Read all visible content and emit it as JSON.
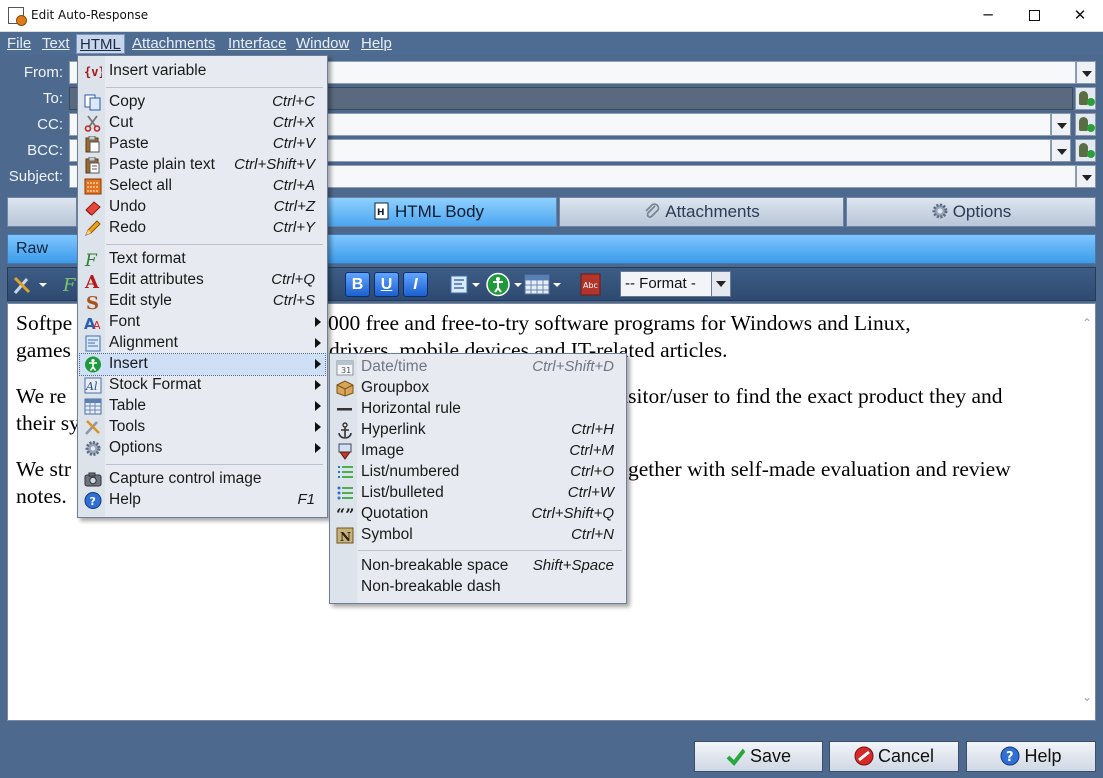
{
  "window": {
    "title": "Edit Auto-Response",
    "minimize": "─",
    "close": "✕"
  },
  "menubar": [
    "File",
    "Text",
    "HTML",
    "Attachments",
    "Interface",
    "Window",
    "Help"
  ],
  "fields": {
    "from_label": "From:",
    "to_label": "To:",
    "cc_label": "CC:",
    "bcc_label": "BCC:",
    "subject_label": "Subject:",
    "from_value": "",
    "to_value": "",
    "cc_value": "",
    "bcc_value": "",
    "subject_value": ""
  },
  "tabs": {
    "html_body": "HTML Body",
    "attachments": "Attachments",
    "options": "Options"
  },
  "subtab": "Raw",
  "toolbar": {
    "bold": "B",
    "underline": "U",
    "italic": "I",
    "format_select": "-- Format -"
  },
  "editor": {
    "p1_visible_start": "Softpe",
    "p1_visible_mid": "00.000 free and free-to-try software programs for Windows and Linux,",
    "p1_line2_start": "games",
    "p1_line2_end": "drivers, mobile devices and IT-related articles.",
    "p2_start": "We re",
    "p2_end": "isitor/user to find the exact product they and",
    "p2_line2_start": "their sy",
    "p3_start": "We str",
    "p3_end": "gether with self-made evaluation and review",
    "p3_line2": "notes."
  },
  "html_menu": {
    "items": [
      {
        "label": "Insert variable",
        "shortcut": "",
        "icon": "variable-icon"
      },
      {
        "label": "Copy",
        "shortcut": "Ctrl+C",
        "icon": "copy-icon"
      },
      {
        "label": "Cut",
        "shortcut": "Ctrl+X",
        "icon": "scissors-icon"
      },
      {
        "label": "Paste",
        "shortcut": "Ctrl+V",
        "icon": "paste-icon"
      },
      {
        "label": "Paste plain text",
        "shortcut": "Ctrl+Shift+V",
        "icon": "paste-plain-icon"
      },
      {
        "label": "Select all",
        "shortcut": "Ctrl+A",
        "icon": "select-all-icon"
      },
      {
        "label": "Undo",
        "shortcut": "Ctrl+Z",
        "icon": "eraser-icon"
      },
      {
        "label": "Redo",
        "shortcut": "Ctrl+Y",
        "icon": "pencil-icon"
      },
      {
        "label": "Text format",
        "shortcut": "",
        "icon": "text-format-icon"
      },
      {
        "label": "Edit attributes",
        "shortcut": "Ctrl+Q",
        "icon": "letter-a-icon"
      },
      {
        "label": "Edit style",
        "shortcut": "Ctrl+S",
        "icon": "letter-s-icon"
      },
      {
        "label": "Font",
        "shortcut": "",
        "icon": "font-icon"
      },
      {
        "label": "Alignment",
        "shortcut": "",
        "icon": "alignment-icon"
      },
      {
        "label": "Insert",
        "shortcut": "",
        "icon": "insert-icon"
      },
      {
        "label": "Stock Format",
        "shortcut": "",
        "icon": "stock-format-icon"
      },
      {
        "label": "Table",
        "shortcut": "",
        "icon": "table-icon"
      },
      {
        "label": "Tools",
        "shortcut": "",
        "icon": "tools-icon"
      },
      {
        "label": "Options",
        "shortcut": "",
        "icon": "gear-icon"
      },
      {
        "label": "Capture control image",
        "shortcut": "",
        "icon": "camera-icon"
      },
      {
        "label": "Help",
        "shortcut": "F1",
        "icon": "help-icon"
      }
    ]
  },
  "insert_menu": {
    "items": [
      {
        "label": "Date/time",
        "shortcut": "Ctrl+Shift+D",
        "icon": "calendar-icon"
      },
      {
        "label": "Groupbox",
        "shortcut": "",
        "icon": "box-icon"
      },
      {
        "label": "Horizontal rule",
        "shortcut": "",
        "icon": "horizontal-rule-icon"
      },
      {
        "label": "Hyperlink",
        "shortcut": "Ctrl+H",
        "icon": "anchor-icon"
      },
      {
        "label": "Image",
        "shortcut": "Ctrl+M",
        "icon": "image-icon"
      },
      {
        "label": "List/numbered",
        "shortcut": "Ctrl+O",
        "icon": "numbered-list-icon"
      },
      {
        "label": "List/bulleted",
        "shortcut": "Ctrl+W",
        "icon": "bulleted-list-icon"
      },
      {
        "label": "Quotation",
        "shortcut": "Ctrl+Shift+Q",
        "icon": "quote-icon"
      },
      {
        "label": "Symbol",
        "shortcut": "Ctrl+N",
        "icon": "symbol-icon"
      },
      {
        "label": "Non-breakable space",
        "shortcut": "Shift+Space",
        "icon": ""
      },
      {
        "label": "Non-breakable dash",
        "shortcut": "",
        "icon": ""
      }
    ]
  },
  "buttons": {
    "save": "Save",
    "cancel": "Cancel",
    "help": "Help"
  },
  "colors": {
    "frame": "#4d6a8e",
    "selected_tab": "#4da6f0",
    "menu_bg": "#e7ebf1"
  }
}
